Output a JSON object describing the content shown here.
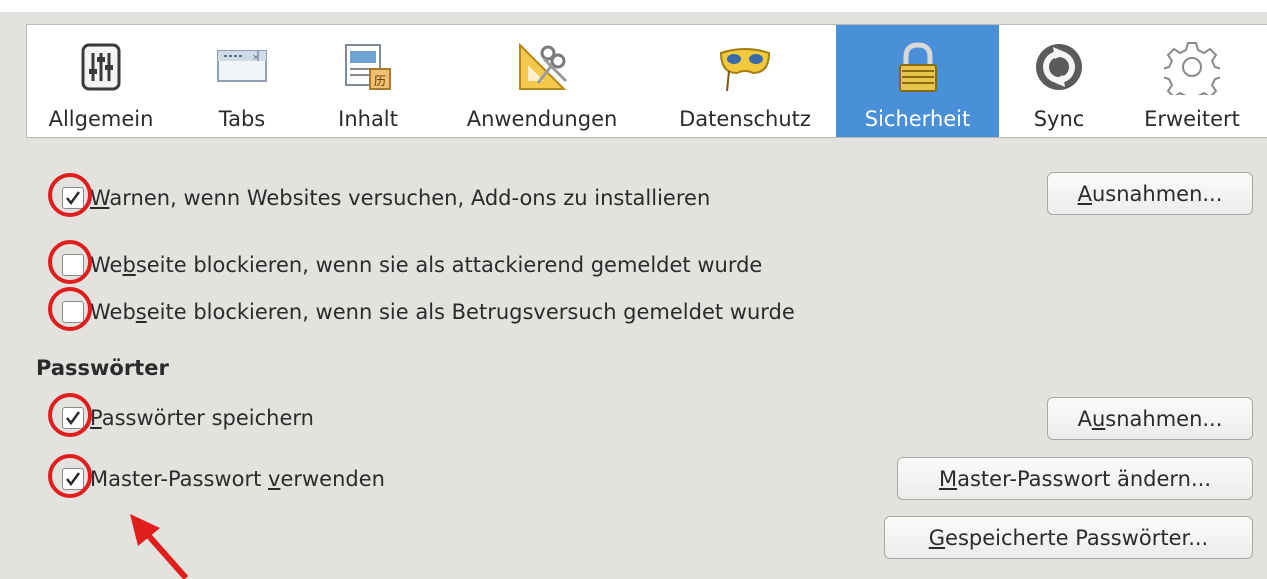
{
  "toolbar": {
    "tabs": [
      {
        "label": "Allgemein",
        "icon": "sliders-icon"
      },
      {
        "label": "Tabs",
        "icon": "tabs-icon"
      },
      {
        "label": "Inhalt",
        "icon": "content-icon"
      },
      {
        "label": "Anwendungen",
        "icon": "applications-icon"
      },
      {
        "label": "Datenschutz",
        "icon": "privacy-mask-icon"
      },
      {
        "label": "Sicherheit",
        "icon": "padlock-icon",
        "active": true
      },
      {
        "label": "Sync",
        "icon": "sync-icon"
      },
      {
        "label": "Erweitert",
        "icon": "gear-icon"
      }
    ]
  },
  "security": {
    "addons": {
      "label_pre": "",
      "accel": "W",
      "label_post": "arnen, wenn Websites versuchen, Add-ons zu installieren",
      "checked": true
    },
    "addons_button": {
      "pre": "",
      "accel": "A",
      "post": "usnahmen..."
    },
    "attack": {
      "label_pre": "We",
      "accel": "b",
      "label_post": "seite blockieren, wenn sie als attackierend gemeldet wurde",
      "checked": false
    },
    "forgery": {
      "label_pre": "Web",
      "accel": "s",
      "label_post": "eite blockieren, wenn sie als Betrugsversuch gemeldet wurde",
      "checked": false
    }
  },
  "passwords": {
    "heading": "Passwörter",
    "remember": {
      "label_pre": "",
      "accel": "P",
      "label_post": "asswörter speichern",
      "checked": true
    },
    "remember_button": {
      "pre": "A",
      "accel": "u",
      "post": "snahmen..."
    },
    "master": {
      "label_pre": "Master-Passwort ",
      "accel": "v",
      "label_post": "erwenden",
      "checked": true
    },
    "change_master_button": {
      "pre": "",
      "accel": "M",
      "post": "aster-Passwort ändern..."
    },
    "saved_button": {
      "pre": "",
      "accel": "G",
      "post": "espeicherte Passwörter..."
    }
  },
  "colors": {
    "active_tab": "#4a90d9",
    "annotation": "#e01e1e"
  }
}
